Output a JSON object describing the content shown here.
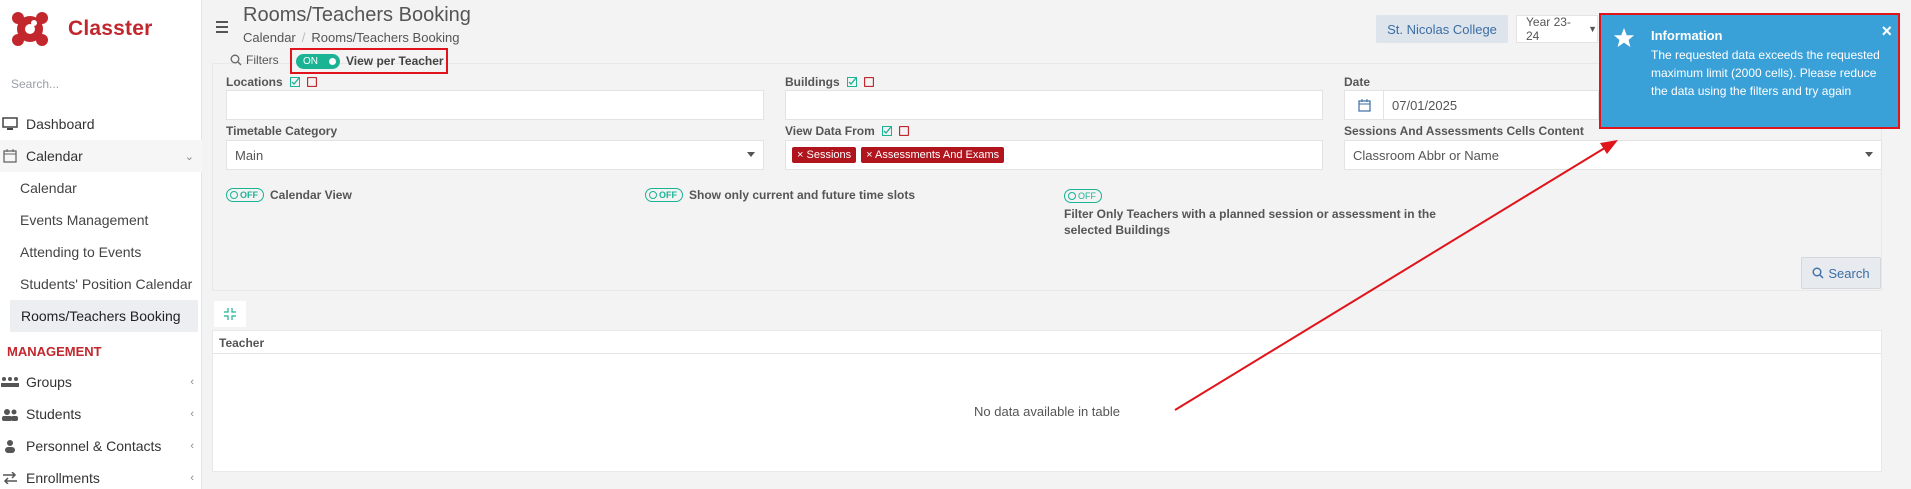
{
  "sidebar": {
    "brand": "Classter",
    "search_placeholder": "Search...",
    "items": [
      {
        "label": "Dashboard"
      },
      {
        "label": "Calendar"
      }
    ],
    "calendar_sub": [
      {
        "label": "Calendar"
      },
      {
        "label": "Events Management"
      },
      {
        "label": "Attending to Events"
      },
      {
        "label": "Students' Position Calendar"
      },
      {
        "label": "Rooms/Teachers Booking"
      }
    ],
    "section": "MANAGEMENT",
    "management_items": [
      {
        "label": "Groups"
      },
      {
        "label": "Students"
      },
      {
        "label": "Personnel & Contacts"
      },
      {
        "label": "Enrollments"
      }
    ]
  },
  "header": {
    "title": "Rooms/Teachers Booking",
    "breadcrumb": [
      "Calendar",
      "Rooms/Teachers Booking"
    ],
    "college": "St. Nicolas College",
    "year": "Year 23-24"
  },
  "filters": {
    "label": "Filters",
    "toggle_state": "ON",
    "toggle_label": "View per Teacher",
    "locations_label": "Locations",
    "buildings_label": "Buildings",
    "date_label": "Date",
    "date_value": "07/01/2025",
    "timetable_label": "Timetable Category",
    "timetable_value": "Main",
    "view_data_label": "View Data From",
    "view_data_tags": [
      "Sessions",
      "Assessments And Exams"
    ],
    "cells_content_label": "Sessions And Assessments Cells Content",
    "cells_content_value": "Classroom Abbr or Name",
    "off_text": "OFF",
    "opt_calendar_view": "Calendar View",
    "opt_future": "Show only current and future time slots",
    "opt_filter_teachers": "Filter Only Teachers with a planned session or assessment in the selected Buildings",
    "search_button": "Search"
  },
  "table": {
    "column": "Teacher",
    "empty": "No data available in table"
  },
  "notification": {
    "title": "Information",
    "message": "The requested data exceeds the requested maximum limit (2000 cells). Please reduce the data using the filters and try again",
    "close": "×"
  },
  "colors": {
    "brand": "#c2272d",
    "toggle": "#1ab394",
    "notification": "#3aa0d8",
    "annotation": "#e0141b"
  }
}
